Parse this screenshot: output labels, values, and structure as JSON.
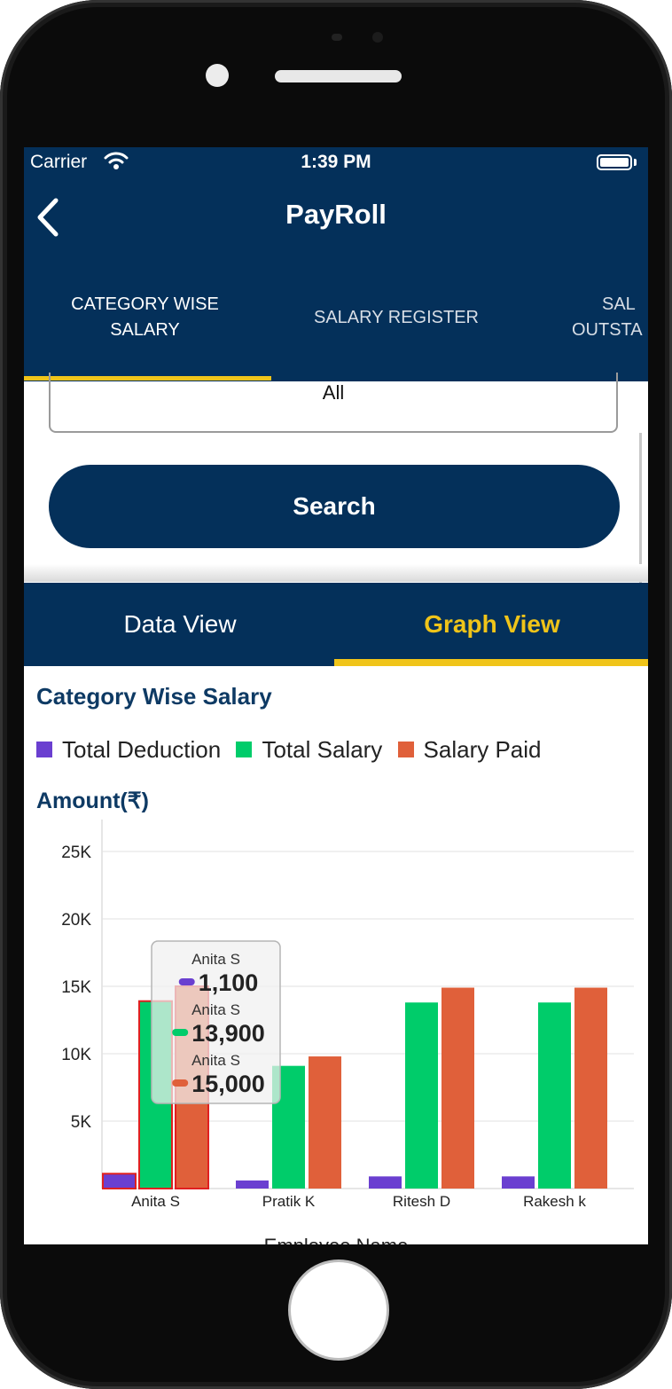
{
  "status_bar": {
    "carrier": "Carrier",
    "time": "1:39 PM"
  },
  "header": {
    "title": "PayRoll"
  },
  "tabs": [
    {
      "label": "CATEGORY WISE SALARY",
      "line1": "CATEGORY WISE",
      "line2": "SALARY",
      "active": true
    },
    {
      "label": "SALARY REGISTER",
      "active": false
    },
    {
      "label": "SALARY OUTSTANDING",
      "line1": "SAL",
      "line2": "OUTSTA",
      "active": false
    }
  ],
  "filter": {
    "selected_value": "All"
  },
  "search_button": {
    "label": "Search"
  },
  "view_tabs": [
    {
      "label": "Data View",
      "active": false
    },
    {
      "label": "Graph View",
      "active": true
    }
  ],
  "colors": {
    "primary": "#04305a",
    "accent": "#f0c419",
    "deduction": "#6a3fd0",
    "salary": "#00cc6a",
    "paid": "#e0603a"
  },
  "chart_data": {
    "type": "bar",
    "title": "Category Wise Salary",
    "ylabel": "Amount(₹)",
    "xlabel": "Employee Name",
    "categories": [
      "Anita S",
      "Pratik K",
      "Ritesh D",
      "Rakesh k"
    ],
    "series": [
      {
        "name": "Total Deduction",
        "color": "#6a3fd0",
        "values": [
          1100,
          600,
          900,
          900
        ]
      },
      {
        "name": "Total Salary",
        "color": "#00cc6a",
        "values": [
          13900,
          9100,
          13800,
          13800
        ]
      },
      {
        "name": "Salary Paid",
        "color": "#e0603a",
        "values": [
          15000,
          9800,
          14900,
          14900
        ]
      }
    ],
    "ylim": [
      0,
      25000
    ],
    "yticks": [
      "5K",
      "10K",
      "15K",
      "20K",
      "25K"
    ],
    "ytick_values": [
      5000,
      10000,
      15000,
      20000,
      25000
    ],
    "legend": "top-left",
    "grid": true,
    "tooltip": {
      "category": "Anita S",
      "entries": [
        {
          "label": "Anita S",
          "value": "1,100"
        },
        {
          "label": "Anita S",
          "value": "13,900"
        },
        {
          "label": "Anita S",
          "value": "15,000"
        }
      ]
    }
  }
}
